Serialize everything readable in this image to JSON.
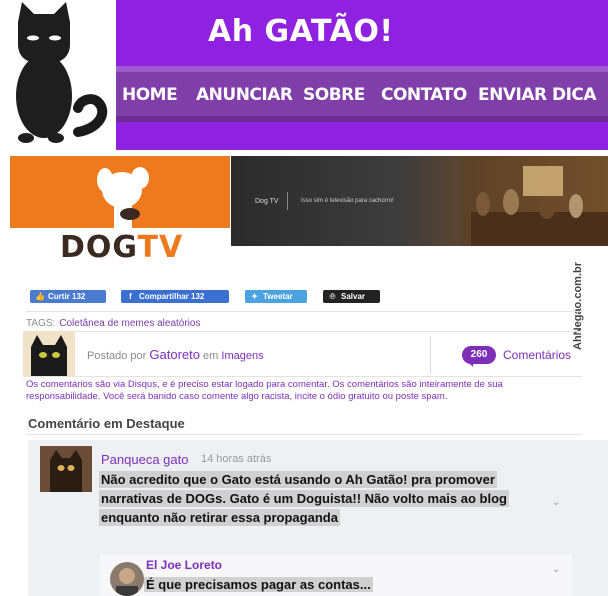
{
  "header": {
    "site_title": "Ah GATÃO!",
    "nav": [
      "HOME",
      "ANUNCIAR",
      "SOBRE",
      "CONTATO",
      "ENVIAR DICA"
    ],
    "brand_color": "#8f22e0"
  },
  "banner": {
    "logo_word_dog": "DOG",
    "logo_word_tv": "TV",
    "video_channel": "Dog TV",
    "video_tagline": "Isso sim é televisão para cachorro!",
    "watermark": "AhNegao.com.br"
  },
  "share": {
    "like_label": "Curtir",
    "like_count": "132",
    "share_label": "Compartilhar",
    "share_count": "132",
    "tweet_label": "Tweetar",
    "save_label": "Salvar"
  },
  "tags": {
    "label": "TAGS:",
    "value": "Coletânea de memes aleatórios"
  },
  "post": {
    "posted_by_prefix": "Postado por",
    "author": "Gatoreto",
    "in_label": "em",
    "category": "Imagens",
    "comment_count": "260",
    "comments_label": "Comentários"
  },
  "notice": "Os comentários são via Disqus, e é preciso estar logado para comentar. Os comentários são inteiramente de sua responsabilidade. Você será banido caso comente algo racista, incite o ódio gratuito ou poste spam.",
  "comments": {
    "featured_heading": "Comentário em Destaque",
    "featured": {
      "author": "Panqueca gato",
      "time": "14 horas atrás",
      "lines": [
        "Não acredito que o Gato está usando o Ah Gatão! pra promover",
        "narrativas de DOGs.  Gato é um Doguista!! Não volto mais ao blog",
        "enquanto não retirar essa propaganda"
      ]
    },
    "reply": {
      "author": "El Joe Loreto",
      "body": "É que precisamos pagar as contas..."
    }
  }
}
